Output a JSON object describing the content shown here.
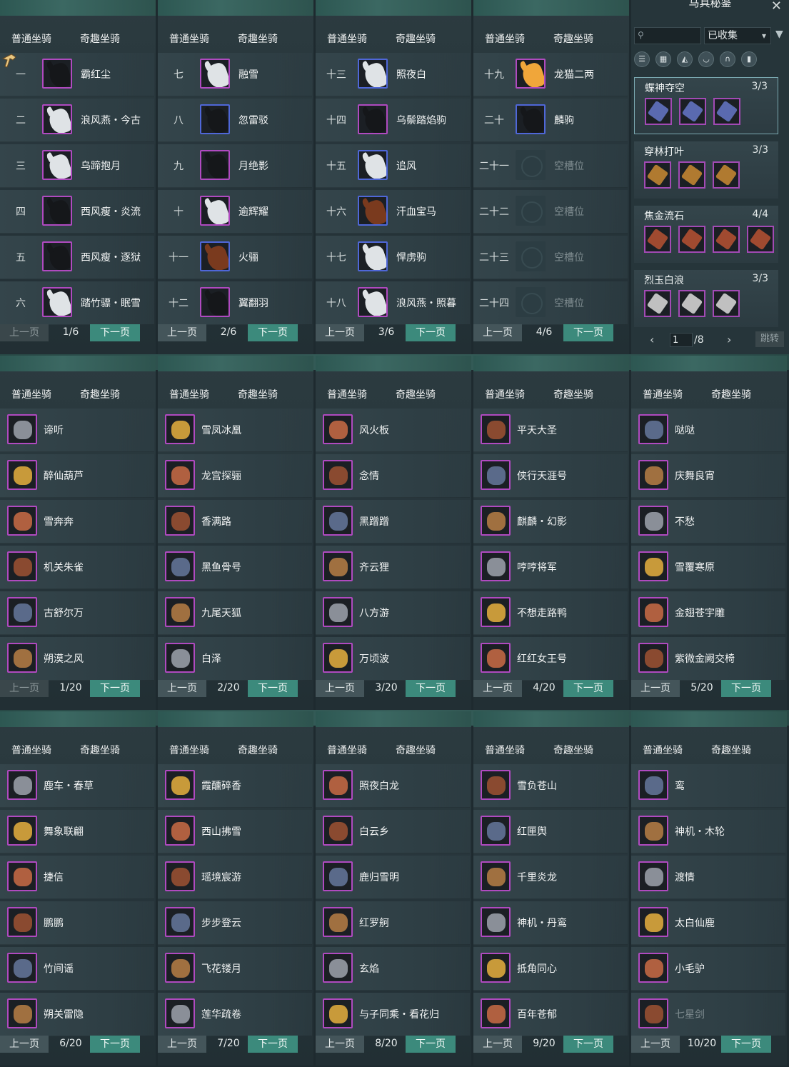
{
  "colors": {
    "accent": "#3c8a7c",
    "rarity_purple": "#b04ac0",
    "rarity_blue": "#4f67d8",
    "rarity_gold": "#d2a042"
  },
  "tabs": {
    "normal": "普通坐骑",
    "fun": "奇趣坐骑"
  },
  "pager": {
    "prev": "上一页",
    "next": "下一页"
  },
  "horse_panels": [
    {
      "page": "1/6",
      "prev_disabled": true,
      "rows": [
        {
          "num": "一",
          "name": "霸红尘",
          "border": "purple",
          "icon": "black-horse-icon"
        },
        {
          "num": "二",
          "name": "浪风燕・今古",
          "border": "purple",
          "icon": "white-horse-icon"
        },
        {
          "num": "三",
          "name": "乌蹄抱月",
          "border": "purple",
          "icon": "white-horse-icon"
        },
        {
          "num": "四",
          "name": "西风瘦・炎流",
          "border": "purple",
          "icon": "black-horse-icon"
        },
        {
          "num": "五",
          "name": "西风瘦・逐狱",
          "border": "purple",
          "icon": "black-horse-icon"
        },
        {
          "num": "六",
          "name": "踏竹骠・眠雪",
          "border": "purple",
          "icon": "white-horse-icon"
        }
      ]
    },
    {
      "page": "2/6",
      "prev_disabled": false,
      "rows": [
        {
          "num": "七",
          "name": "融雪",
          "border": "purple",
          "icon": "white-horse-icon"
        },
        {
          "num": "八",
          "name": "忽雷驳",
          "border": "blue",
          "icon": "black-horse-icon"
        },
        {
          "num": "九",
          "name": "月绝影",
          "border": "purple",
          "icon": "black-horse-icon"
        },
        {
          "num": "十",
          "name": "逾辉耀",
          "border": "purple",
          "icon": "white-horse-icon"
        },
        {
          "num": "十一",
          "name": "火骊",
          "border": "blue",
          "icon": "brown-horse-icon"
        },
        {
          "num": "十二",
          "name": "翼翻羽",
          "border": "purple",
          "icon": "black-horse-icon"
        }
      ]
    },
    {
      "page": "3/6",
      "prev_disabled": false,
      "rows": [
        {
          "num": "十三",
          "name": "照夜白",
          "border": "blue",
          "icon": "white-horse-icon"
        },
        {
          "num": "十四",
          "name": "乌鬃踏焰驹",
          "border": "purple",
          "icon": "black-horse-icon"
        },
        {
          "num": "十五",
          "name": "追风",
          "border": "blue",
          "icon": "white-horse-icon"
        },
        {
          "num": "十六",
          "name": "汗血宝马",
          "border": "blue",
          "icon": "brown-horse-icon"
        },
        {
          "num": "十七",
          "name": "悍虏驹",
          "border": "blue",
          "icon": "white-horse-icon"
        },
        {
          "num": "十八",
          "name": "浪风燕・照暮",
          "border": "purple",
          "icon": "white-horse-icon"
        }
      ]
    },
    {
      "page": "4/6",
      "prev_disabled": false,
      "rows": [
        {
          "num": "十九",
          "name": "龙猫二两",
          "border": "purple",
          "icon": "fox-icon"
        },
        {
          "num": "二十",
          "name": "麟驹",
          "border": "blue",
          "icon": "black-horse-icon"
        },
        {
          "num": "二十一",
          "name": "空槽位",
          "border": "empty",
          "icon": "empty-slot-icon"
        },
        {
          "num": "二十二",
          "name": "空槽位",
          "border": "empty",
          "icon": "empty-slot-icon"
        },
        {
          "num": "二十三",
          "name": "空槽位",
          "border": "empty",
          "icon": "empty-slot-icon"
        },
        {
          "num": "二十四",
          "name": "空槽位",
          "border": "empty",
          "icon": "empty-slot-icon"
        }
      ]
    }
  ],
  "side_panel": {
    "title": "马具秘鉴",
    "filter_value": "已收集",
    "categories": [
      "list-icon",
      "grid-icon",
      "saddle-icon",
      "armor-icon",
      "horseshoe-icon",
      "ornament-icon"
    ],
    "sets": [
      {
        "name": "蝶神夺空",
        "count": "3/3",
        "items": 3
      },
      {
        "name": "穿林打叶",
        "count": "3/3",
        "items": 3
      },
      {
        "name": "焦金流石",
        "count": "4/4",
        "items": 4
      },
      {
        "name": "烈玉白浪",
        "count": "3/3",
        "items": 3
      }
    ],
    "page_value": "1",
    "page_total": "/8",
    "jump_label": "跳转"
  },
  "fun_panels": [
    {
      "page": "1/20",
      "prev_disabled": true,
      "rows": [
        "谛听",
        "醉仙葫芦",
        "雪奔奔",
        "机关朱雀",
        "古舒尔万",
        "朔漠之风"
      ]
    },
    {
      "page": "2/20",
      "prev_disabled": false,
      "rows": [
        "雪凤冰凰",
        "龙宫探骊",
        "香满路",
        "黑鱼骨号",
        "九尾天狐",
        "白泽"
      ]
    },
    {
      "page": "3/20",
      "prev_disabled": false,
      "rows": [
        "风火板",
        "念情",
        "黑蹭蹭",
        "齐云狸",
        "八方游",
        "万顷波"
      ]
    },
    {
      "page": "4/20",
      "prev_disabled": false,
      "rows": [
        "平天大圣",
        "侠行天涯号",
        "麒麟・幻影",
        "哼哼将军",
        "不想走路鸭",
        "红红女王号"
      ]
    },
    {
      "page": "5/20",
      "prev_disabled": false,
      "rows": [
        "哒哒",
        "庆舞良宵",
        "不愁",
        "雪覆寒原",
        "金翅苍宇雕",
        "紫微金阙交椅"
      ]
    },
    {
      "page": "6/20",
      "prev_disabled": false,
      "rows": [
        "鹿车・春草",
        "舞象联翩",
        "捷信",
        "鹏鹏",
        "竹间谣",
        "朔关雷隐"
      ]
    },
    {
      "page": "7/20",
      "prev_disabled": false,
      "rows": [
        "霞醺碎香",
        "西山拂雪",
        "瑶境宸游",
        "步步登云",
        "飞花镂月",
        "莲华疏卷"
      ]
    },
    {
      "page": "8/20",
      "prev_disabled": false,
      "rows": [
        "照夜白龙",
        "白云乡",
        "鹿归雪明",
        "红罗舸",
        "玄焰",
        "与子同乘・看花归"
      ]
    },
    {
      "page": "9/20",
      "prev_disabled": false,
      "rows": [
        "雪负苍山",
        "红匣舆",
        "千里炎龙",
        "神机・丹鸾",
        "抵角同心",
        "百年苍郁"
      ]
    },
    {
      "page": "10/20",
      "prev_disabled": false,
      "rows": [
        "鸾",
        "神机・木轮",
        "渡情",
        "太白仙鹿",
        "小毛驴",
        "七星剑"
      ]
    }
  ]
}
